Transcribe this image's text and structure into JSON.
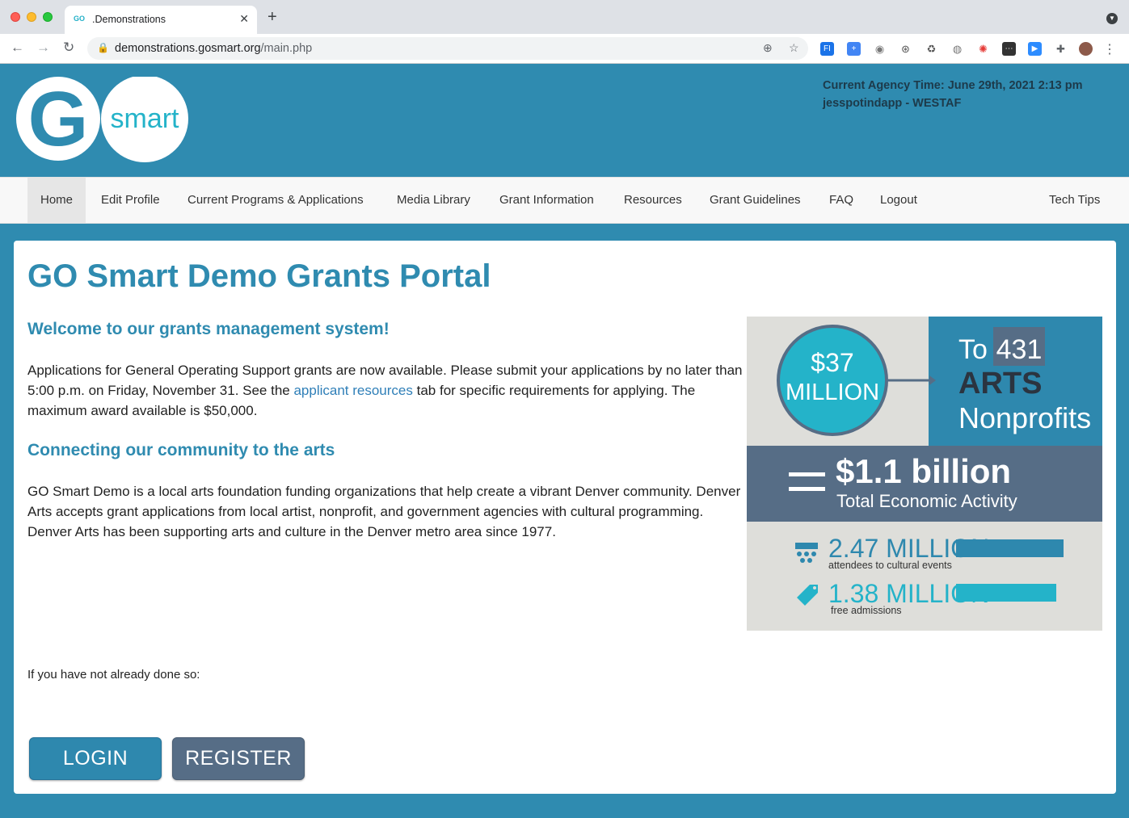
{
  "browser": {
    "tab_title": ".Demonstrations",
    "tab_favicon": "GO",
    "url_host": "demonstrations.gosmart.org",
    "url_path": "/main.php"
  },
  "header": {
    "logo_go": "G",
    "logo_smart": "smart",
    "agency_time": "Current Agency Time: June 29th, 2021 2:13 pm",
    "agency_user": "jesspotindapp - WESTAF"
  },
  "nav": {
    "items": [
      "Home",
      "Edit Profile",
      "Current Programs & Applications",
      "Media Library",
      "Grant Information",
      "Resources",
      "Grant Guidelines",
      "FAQ",
      "Logout"
    ],
    "right_item": "Tech Tips"
  },
  "main": {
    "title": "GO Smart Demo Grants Portal",
    "welcome_heading": "Welcome to our grants management system!",
    "welcome_text_1": "Applications for General Operating Support grants are now available. Please submit your applications by no later than 5:00 p.m. on Friday, November 31. See the ",
    "welcome_link": "applicant resources",
    "welcome_text_2": " tab for specific requirements for applying. The maximum award available is $50,000.",
    "community_heading": "Connecting our community to the arts",
    "community_text": "GO Smart Demo is a local arts foundation funding organizations that help create a vibrant Denver community. Denver Arts accepts grant applications from local artist, nonprofit, and government agencies with cultural programming. Denver Arts has been supporting arts and culture in the Denver metro area since 1977.",
    "notice": "If you have not already done so:",
    "login_label": "LOGIN",
    "register_label": "REGISTER"
  },
  "infographic": {
    "amount_top": "$37",
    "amount_bottom": "MILLION",
    "to": "To",
    "count": "431",
    "arts": "ARTS",
    "nonprofits": "Nonprofits",
    "equals": "=",
    "billion": "$1.1 billion",
    "economic": "Total Economic Activity",
    "attendees_value": "2.47 MILLION",
    "attendees_label": "attendees to cultural events",
    "free_value": "1.38 MILLION",
    "free_label": "free admissions"
  },
  "colors": {
    "brand_blue": "#2f8bb0",
    "teal": "#24b3c9",
    "slate": "#566d86"
  }
}
